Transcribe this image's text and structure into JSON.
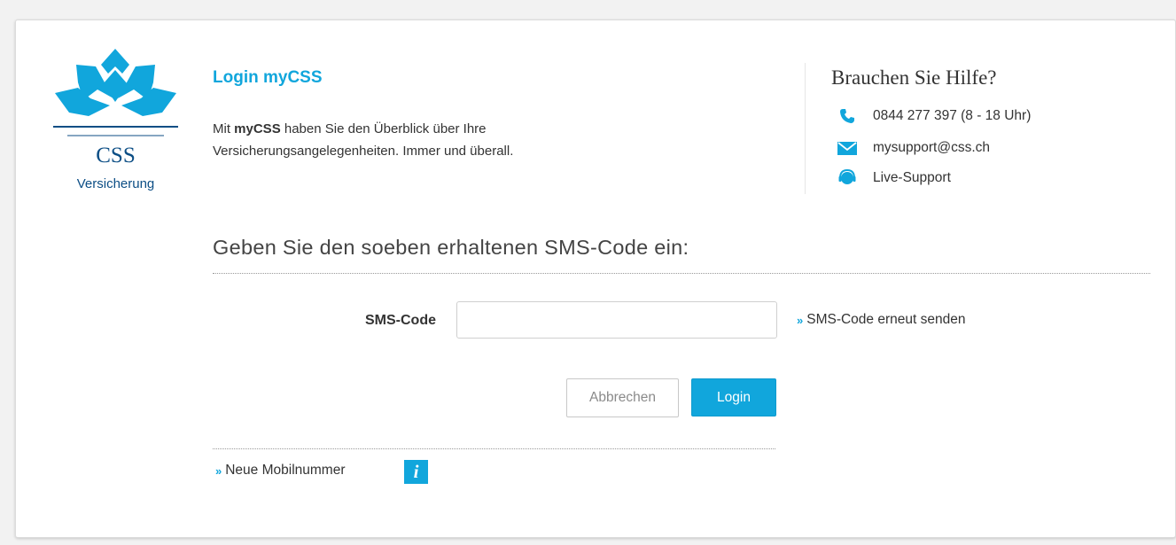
{
  "logo": {
    "name": "CSS",
    "subtitle": "Versicherung"
  },
  "header": {
    "title": "Login myCSS",
    "intro_prefix": "Mit ",
    "intro_bold": "myCSS",
    "intro_line1_rest": " haben Sie den Überblick über Ihre",
    "intro_line2": "Versicherungsangelegenheiten. Immer und überall."
  },
  "help": {
    "title": "Brauchen Sie Hilfe?",
    "phone": "0844 277 397 (8 - 18 Uhr)",
    "email": "mysupport@css.ch",
    "live_support": "Live-Support",
    "icons": [
      "phone-icon",
      "mail-icon",
      "live-support-icon"
    ]
  },
  "form": {
    "heading": "Geben Sie den soeben erhaltenen SMS-Code ein:",
    "sms_label": "SMS-Code",
    "sms_value": "",
    "sms_placeholder": "",
    "resend_link": "SMS-Code erneut senden",
    "cancel_label": "Abbrechen",
    "login_label": "Login",
    "new_number_link": "Neue Mobilnummer",
    "info_icon_glyph": "i"
  },
  "colors": {
    "accent": "#11a6dc",
    "logo_blue": "#0c4e85",
    "text": "#333333"
  }
}
